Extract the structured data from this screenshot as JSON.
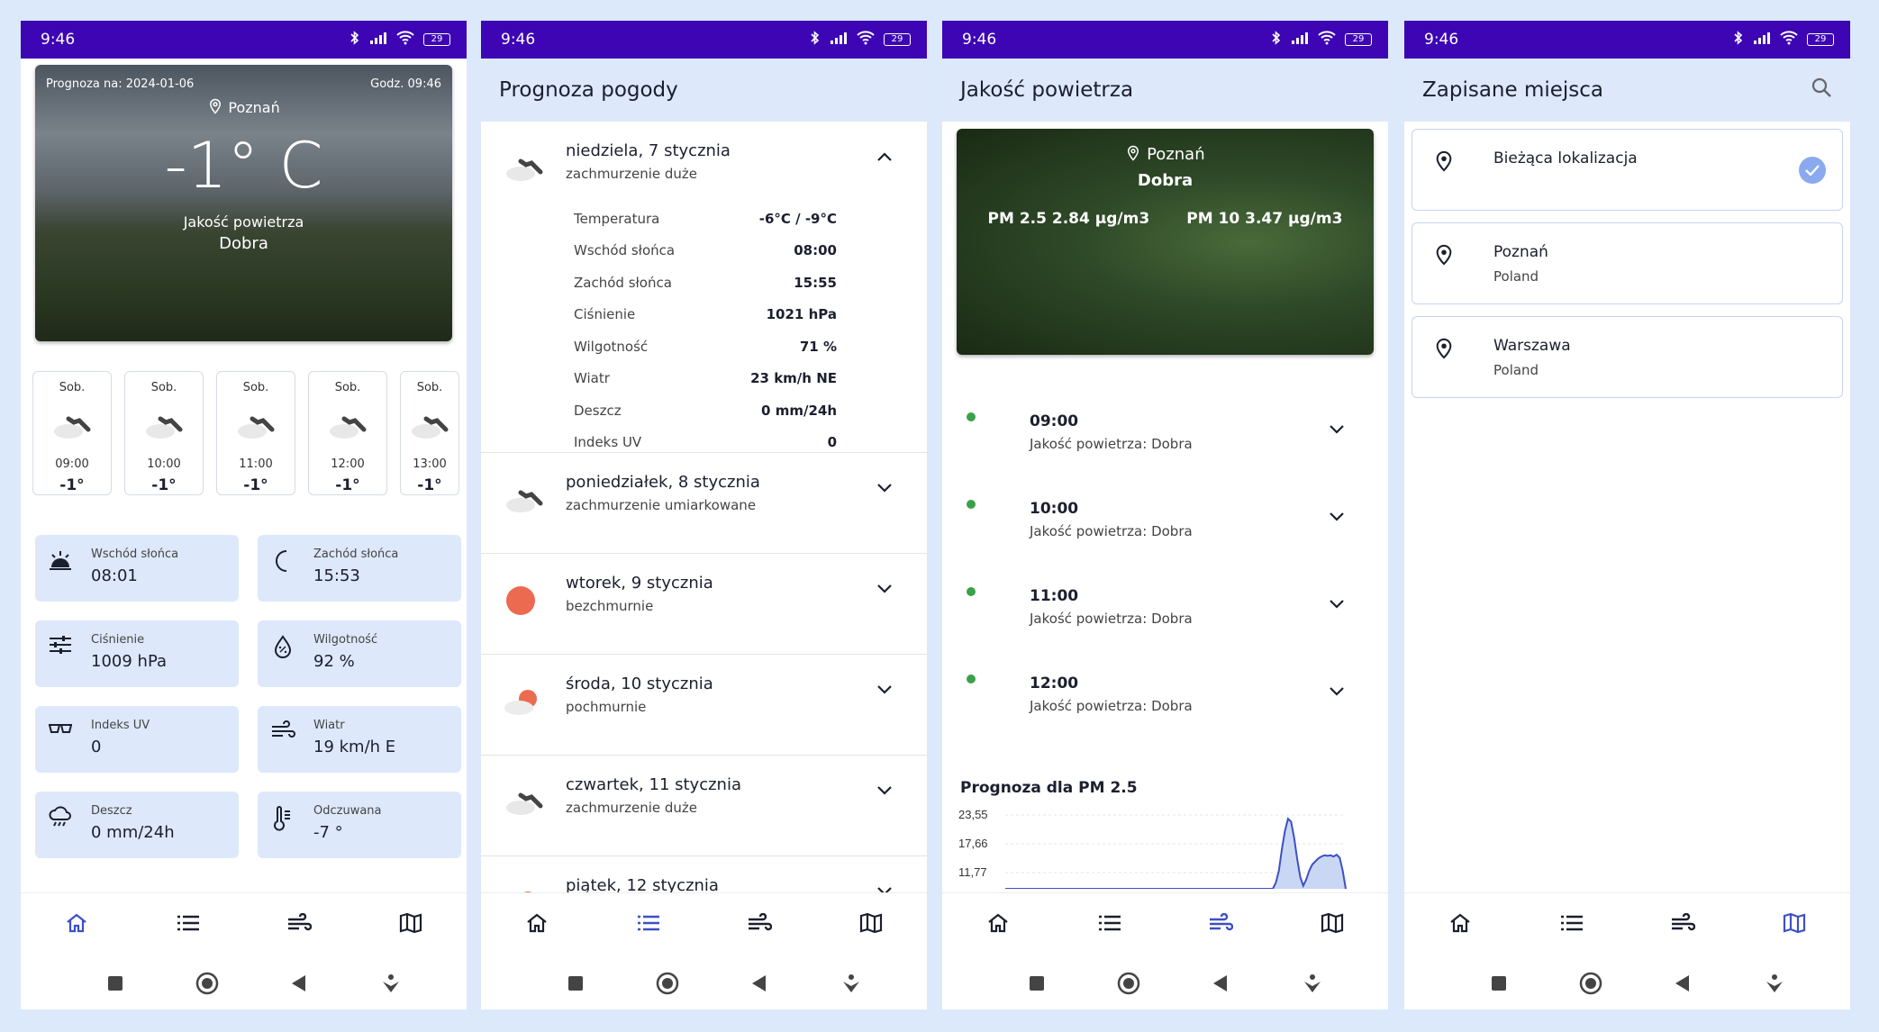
{
  "status": {
    "time": "9:46",
    "battery": "29"
  },
  "home": {
    "forecast_label": "Prognoza na: 2024-01-06",
    "time_label": "Godz. 09:46",
    "location": "Poznań",
    "temperature": "-1° C",
    "aq_label": "Jakość powietrza",
    "aq_value": "Dobra",
    "hours": [
      {
        "day": "Sob.",
        "time": "09:00",
        "temp": "-1°"
      },
      {
        "day": "Sob.",
        "time": "10:00",
        "temp": "-1°"
      },
      {
        "day": "Sob.",
        "time": "11:00",
        "temp": "-1°"
      },
      {
        "day": "Sob.",
        "time": "12:00",
        "temp": "-1°"
      },
      {
        "day": "Sob.",
        "time": "13:00",
        "temp": "-1°"
      }
    ],
    "tiles": [
      {
        "label": "Wschód słońca",
        "value": "08:01",
        "icon": "sunrise-icon"
      },
      {
        "label": "Zachód słońca",
        "value": "15:53",
        "icon": "moon-icon"
      },
      {
        "label": "Ciśnienie",
        "value": "1009 hPa",
        "icon": "sliders-icon"
      },
      {
        "label": "Wilgotność",
        "value": "92 %",
        "icon": "humidity-icon"
      },
      {
        "label": "Indeks UV",
        "value": "0",
        "icon": "glasses-icon"
      },
      {
        "label": "Wiatr",
        "value": "19 km/h E",
        "icon": "wind-icon"
      },
      {
        "label": "Deszcz",
        "value": "0 mm/24h",
        "icon": "rain-icon"
      },
      {
        "label": "Odczuwana",
        "value": "-7 °",
        "icon": "thermometer-icon"
      }
    ]
  },
  "forecast": {
    "title": "Prognoza pogody",
    "days": [
      {
        "name": "niedziela, 7 stycznia",
        "desc": "zachmurzenie duże",
        "icon": "cloudy-icon",
        "expanded": true
      },
      {
        "name": "poniedziałek, 8 stycznia",
        "desc": "zachmurzenie umiarkowane",
        "icon": "cloudy-icon"
      },
      {
        "name": "wtorek, 9 stycznia",
        "desc": "bezchmurnie",
        "icon": "sun-icon"
      },
      {
        "name": "środa, 10 stycznia",
        "desc": "pochmurnie",
        "icon": "partly-cloudy-icon"
      },
      {
        "name": "czwartek, 11 stycznia",
        "desc": "zachmurzenie duże",
        "icon": "cloudy-icon"
      },
      {
        "name": "piątek, 12 stycznia",
        "desc": "",
        "icon": "partly-cloudy-icon"
      }
    ],
    "details": [
      {
        "label": "Temperatura",
        "value": "-6°C / -9°C"
      },
      {
        "label": "Wschód słońca",
        "value": "08:00"
      },
      {
        "label": "Zachód słońca",
        "value": "15:55"
      },
      {
        "label": "Ciśnienie",
        "value": "1021 hPa"
      },
      {
        "label": "Wilgotność",
        "value": "71 %"
      },
      {
        "label": "Wiatr",
        "value": "23 km/h NE"
      },
      {
        "label": "Deszcz",
        "value": "0 mm/24h"
      },
      {
        "label": "Indeks UV",
        "value": "0"
      }
    ]
  },
  "air": {
    "title": "Jakość powietrza",
    "location": "Poznań",
    "quality": "Dobra",
    "pm25": "PM 2.5 2.84 µg/m3",
    "pm10": "PM 10 3.47 µg/m3",
    "items": [
      {
        "time": "09:00",
        "sub": "Jakość powietrza: Dobra"
      },
      {
        "time": "10:00",
        "sub": "Jakość powietrza: Dobra"
      },
      {
        "time": "11:00",
        "sub": "Jakość powietrza: Dobra"
      },
      {
        "time": "12:00",
        "sub": "Jakość powietrza: Dobra"
      }
    ],
    "chart_title": "Prognoza dla PM 2.5",
    "accent": "#3d4fc7"
  },
  "chart_data": {
    "type": "area",
    "title": "Prognoza dla PM 2.5",
    "y_ticks": [
      "23,55",
      "17,66",
      "11,77"
    ],
    "values": [
      0,
      0,
      0,
      0,
      0,
      0,
      0,
      0,
      0,
      0,
      0,
      0,
      0,
      0,
      0,
      0,
      0,
      0,
      0,
      0,
      0,
      0,
      0,
      0,
      0,
      0,
      0,
      0,
      0,
      0,
      0,
      0,
      0,
      0,
      0,
      0,
      0,
      0,
      0,
      0,
      0,
      0,
      0,
      0,
      0,
      0,
      0,
      0,
      0,
      0,
      0,
      0,
      0,
      0,
      0,
      0,
      0,
      0,
      0,
      0,
      0,
      0,
      0,
      0,
      0,
      0,
      0,
      0,
      0,
      0,
      0,
      0,
      0,
      0,
      0,
      0,
      0,
      0,
      0,
      0,
      0,
      0,
      0,
      0,
      0,
      0,
      0,
      0,
      0,
      2,
      6,
      13,
      19,
      23,
      22,
      17,
      10,
      4,
      1,
      3,
      6,
      8,
      9,
      10,
      10.6,
      11,
      10.8,
      11,
      10.6,
      11.2,
      10.2,
      6,
      0
    ],
    "ylim": [
      0,
      26
    ]
  },
  "places": {
    "title": "Zapisane miejsca",
    "items": [
      {
        "name": "Bieżąca lokalizacja",
        "country": "",
        "selected": true
      },
      {
        "name": "Poznań",
        "country": "Poland"
      },
      {
        "name": "Warszawa",
        "country": "Poland"
      }
    ]
  },
  "colors": {
    "status_bar": "#3d05b4",
    "appbar": "#dde8fb",
    "nav_active": "#3d4fc7",
    "nav_inactive": "#1b1f2e"
  }
}
